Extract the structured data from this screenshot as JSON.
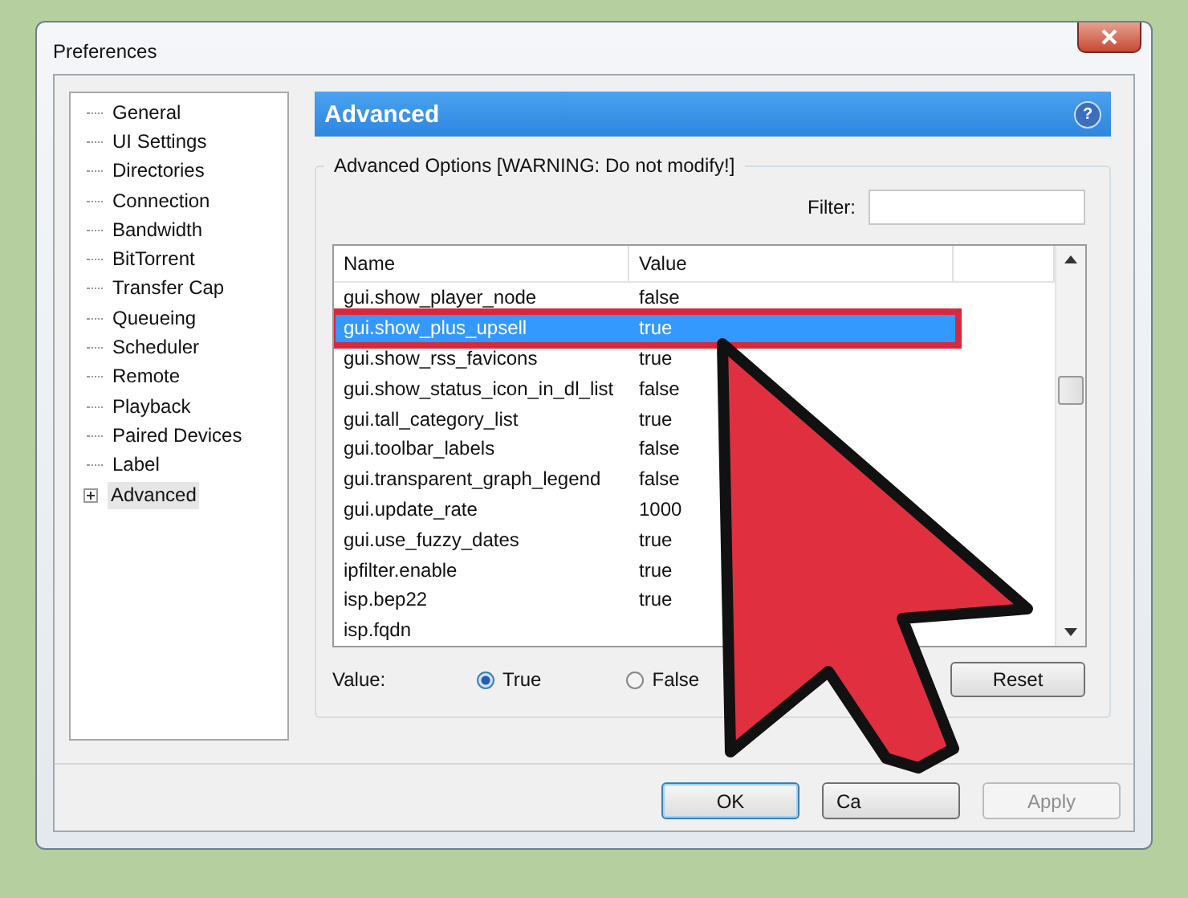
{
  "window": {
    "title": "Preferences"
  },
  "sidebar": {
    "items": [
      {
        "label": "General",
        "selected": false,
        "expandable": false
      },
      {
        "label": "UI Settings",
        "selected": false,
        "expandable": false
      },
      {
        "label": "Directories",
        "selected": false,
        "expandable": false
      },
      {
        "label": "Connection",
        "selected": false,
        "expandable": false
      },
      {
        "label": "Bandwidth",
        "selected": false,
        "expandable": false
      },
      {
        "label": "BitTorrent",
        "selected": false,
        "expandable": false
      },
      {
        "label": "Transfer Cap",
        "selected": false,
        "expandable": false
      },
      {
        "label": "Queueing",
        "selected": false,
        "expandable": false
      },
      {
        "label": "Scheduler",
        "selected": false,
        "expandable": false
      },
      {
        "label": "Remote",
        "selected": false,
        "expandable": false
      },
      {
        "label": "Playback",
        "selected": false,
        "expandable": false
      },
      {
        "label": "Paired Devices",
        "selected": false,
        "expandable": false
      },
      {
        "label": "Label",
        "selected": false,
        "expandable": false
      },
      {
        "label": "Advanced",
        "selected": true,
        "expandable": true
      }
    ]
  },
  "panel": {
    "title": "Advanced",
    "help": "?",
    "group_title": "Advanced Options [WARNING: Do not modify!]",
    "filter": {
      "label": "Filter:"
    }
  },
  "table": {
    "columns": [
      "Name",
      "Value"
    ],
    "rows": [
      {
        "name": "gui.show_player_node",
        "value": "false",
        "selected": false,
        "highlighted": false
      },
      {
        "name": "gui.show_plus_upsell",
        "value": "true",
        "selected": true,
        "highlighted": true
      },
      {
        "name": "gui.show_rss_favicons",
        "value": "true",
        "selected": false,
        "highlighted": false
      },
      {
        "name": "gui.show_status_icon_in_dl_list",
        "value": "false",
        "selected": false,
        "highlighted": false
      },
      {
        "name": "gui.tall_category_list",
        "value": "true",
        "selected": false,
        "highlighted": false
      },
      {
        "name": "gui.toolbar_labels",
        "value": "false",
        "selected": false,
        "highlighted": false
      },
      {
        "name": "gui.transparent_graph_legend",
        "value": "false",
        "selected": false,
        "highlighted": false
      },
      {
        "name": "gui.update_rate",
        "value": "1000",
        "selected": false,
        "highlighted": false
      },
      {
        "name": "gui.use_fuzzy_dates",
        "value": "true",
        "selected": false,
        "highlighted": false
      },
      {
        "name": "ipfilter.enable",
        "value": "true",
        "selected": false,
        "highlighted": false
      },
      {
        "name": "isp.bep22",
        "value": "true",
        "selected": false,
        "highlighted": false
      },
      {
        "name": "isp.fqdn",
        "value": "",
        "selected": false,
        "highlighted": false
      }
    ]
  },
  "value_editor": {
    "label": "Value:",
    "options": [
      {
        "label": "True",
        "selected": true
      },
      {
        "label": "False",
        "selected": false
      }
    ],
    "reset": "Reset"
  },
  "buttons": [
    {
      "label": "OK",
      "default": true,
      "disabled": false
    },
    {
      "label": "Ca",
      "default": false,
      "disabled": false
    },
    {
      "label": "Apply",
      "default": false,
      "disabled": true
    }
  ],
  "annotation": {
    "kind": "arrow"
  }
}
